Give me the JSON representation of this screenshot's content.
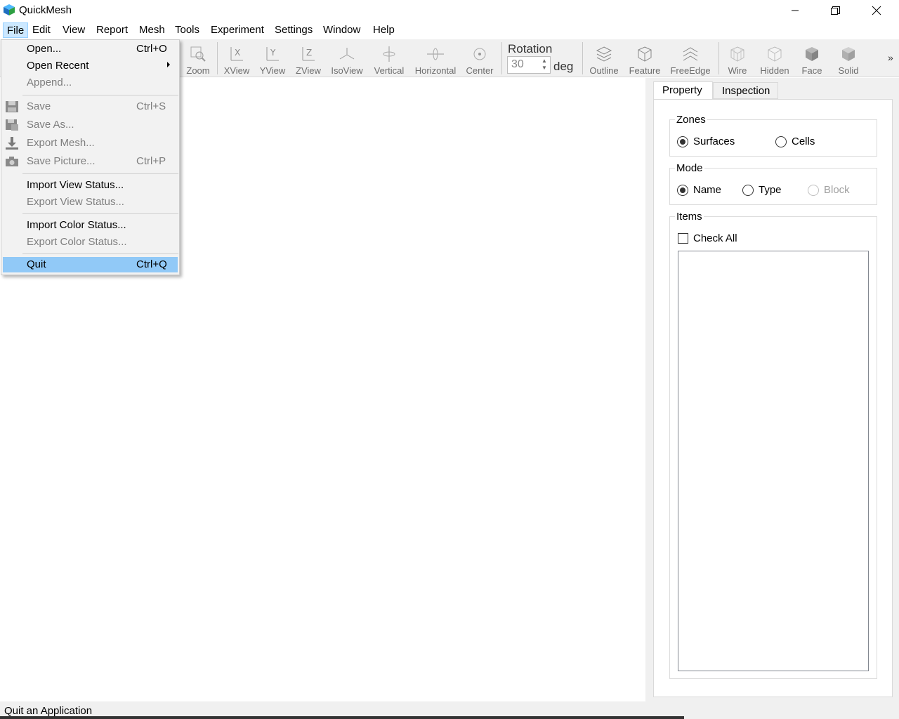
{
  "app": {
    "title": "QuickMesh"
  },
  "menubar": {
    "items": [
      "File",
      "Edit",
      "View",
      "Report",
      "Mesh",
      "Tools",
      "Experiment",
      "Settings",
      "Window",
      "Help"
    ]
  },
  "toolbar": {
    "buttons": [
      "Zoom",
      "XView",
      "YView",
      "ZView",
      "IsoView",
      "Vertical",
      "Horizontal",
      "Center",
      "Outline",
      "Feature",
      "FreeEdge",
      "Wire",
      "Hidden",
      "Face",
      "Solid"
    ],
    "rotation": {
      "label": "Rotation",
      "value": "30",
      "unit": "deg"
    },
    "overflow": "»"
  },
  "file_menu": {
    "open": {
      "label": "Open...",
      "shortcut": "Ctrl+O"
    },
    "open_recent": {
      "label": "Open Recent"
    },
    "append": {
      "label": "Append..."
    },
    "save": {
      "label": "Save",
      "shortcut": "Ctrl+S"
    },
    "save_as": {
      "label": "Save As..."
    },
    "export_mesh": {
      "label": "Export Mesh..."
    },
    "save_picture": {
      "label": "Save Picture...",
      "shortcut": "Ctrl+P"
    },
    "import_view": {
      "label": "Import View Status..."
    },
    "export_view": {
      "label": "Export View Status..."
    },
    "import_color": {
      "label": "Import Color Status..."
    },
    "export_color": {
      "label": "Export Color Status..."
    },
    "quit": {
      "label": "Quit",
      "shortcut": "Ctrl+Q"
    }
  },
  "right_panel": {
    "tabs": [
      "Property",
      "Inspection"
    ],
    "zones": {
      "label": "Zones",
      "options": [
        "Surfaces",
        "Cells"
      ],
      "selected": "Surfaces"
    },
    "mode": {
      "label": "Mode",
      "options": [
        "Name",
        "Type",
        "Block"
      ],
      "selected": "Name"
    },
    "items": {
      "label": "Items",
      "check_all": "Check All"
    }
  },
  "statusbar": {
    "text": "Quit an Application"
  },
  "colors": {
    "menu_highlight": "#91c9f7",
    "menu_active": "#cce8ff"
  }
}
